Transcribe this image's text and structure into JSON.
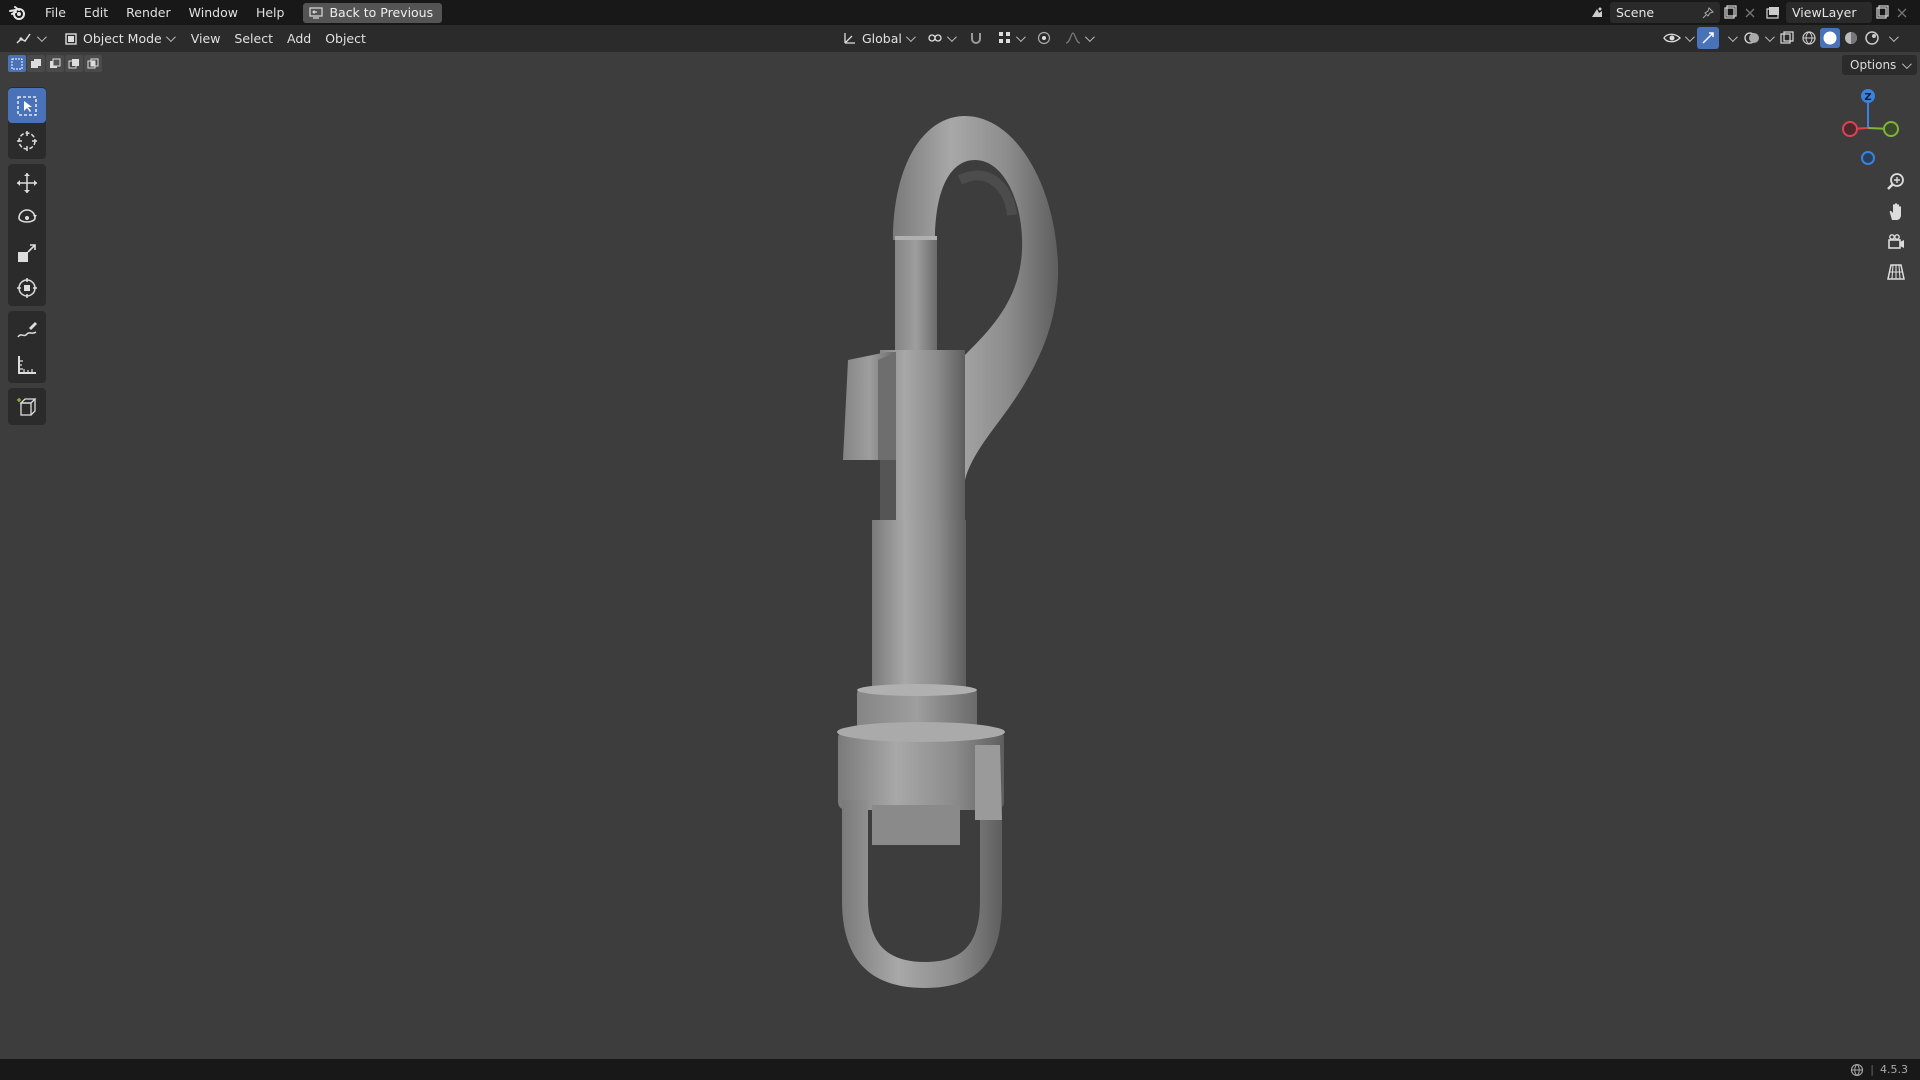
{
  "topbar": {
    "menus": [
      "File",
      "Edit",
      "Render",
      "Window",
      "Help"
    ],
    "back_button": "Back to Previous",
    "scene": "Scene",
    "view_layer": "ViewLayer"
  },
  "header": {
    "mode": "Object Mode",
    "menus": [
      "View",
      "Select",
      "Add",
      "Object"
    ],
    "transform_orientation": "Global"
  },
  "viewport": {
    "options_label": "Options",
    "gizmo_axes": {
      "x": "X",
      "y": "Y",
      "z": "Z"
    }
  },
  "statusbar": {
    "version": "4.5.3"
  },
  "colors": {
    "accent": "#4a72b8",
    "axis_x": "#e0424f",
    "axis_y": "#7fb33a",
    "axis_z": "#3b82e0"
  }
}
